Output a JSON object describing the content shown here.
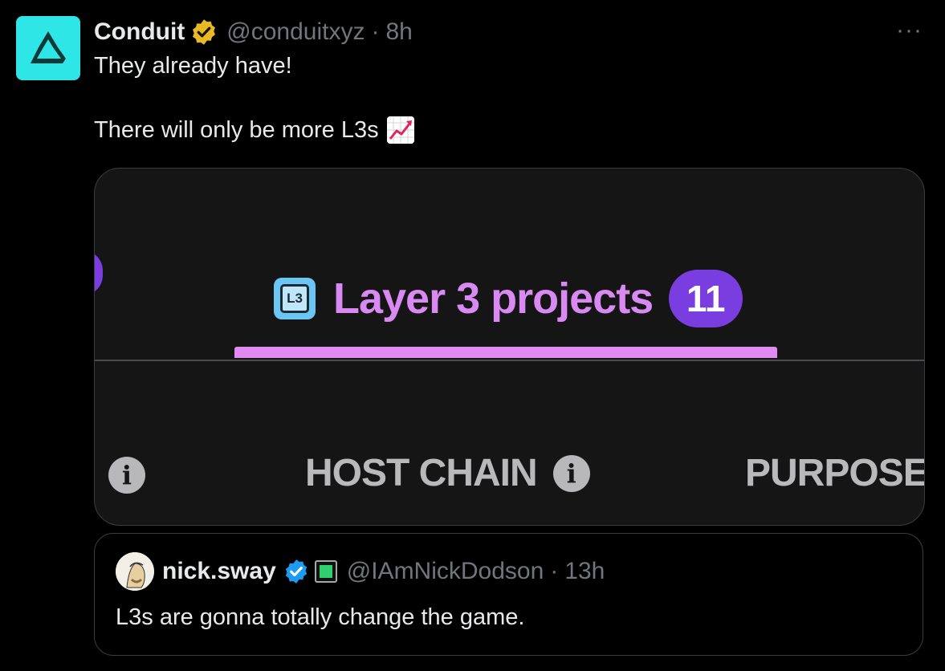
{
  "tweet": {
    "author_name": "Conduit",
    "handle": "@conduitxyz",
    "separator": "·",
    "time": "8h",
    "more_label": "···",
    "text_line1": "They already have!",
    "text_line2": "There will only be more L3s",
    "emoji": "chart-increasing-icon"
  },
  "media": {
    "tab_icon_label": "L3",
    "tab_label": "Layer 3 projects",
    "tab_count": "11",
    "column_host_chain": "HOST CHAIN",
    "column_purpose": "PURPOSE",
    "info_glyph": "i",
    "accent_color": "#d98af2",
    "pill_color": "#7a3ee0"
  },
  "quote": {
    "author_name": "nick.sway",
    "handle": "@IAmNickDodson",
    "separator": "·",
    "time": "13h",
    "text": "L3s are gonna totally change the game."
  },
  "colors": {
    "background": "#000000",
    "text": "#e7e9ea",
    "muted": "#71767b",
    "verified_gold": "#e8b923",
    "verified_blue": "#1d9bf0",
    "avatar_bg": "#2ee6e6"
  }
}
